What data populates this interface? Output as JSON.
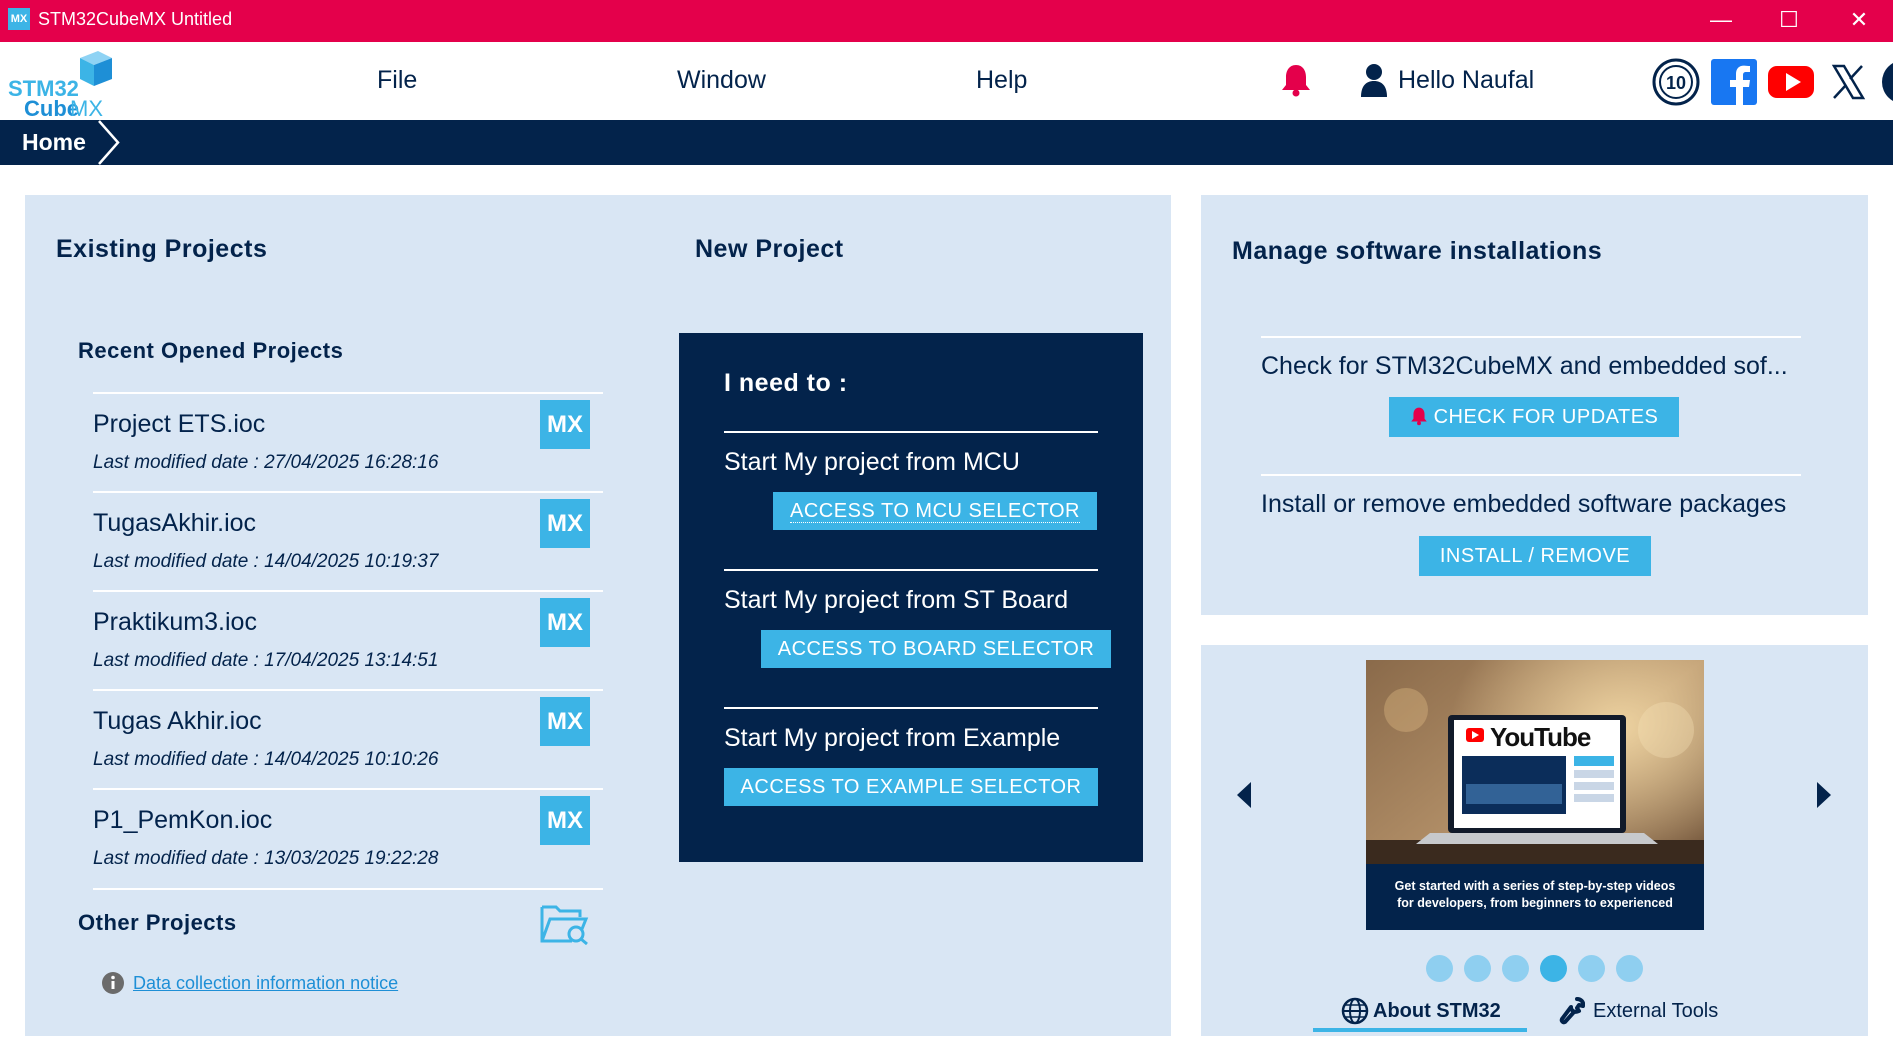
{
  "window": {
    "app_icon": "MX",
    "title": "STM32CubeMX Untitled",
    "controls": {
      "minimize": "—",
      "maximize": "☐",
      "close": "✕"
    }
  },
  "logo": {
    "line1": "STM32",
    "line2_a": "Cube",
    "line2_b": "MX"
  },
  "menu": {
    "file": "File",
    "window": "Window",
    "help": "Help"
  },
  "user": {
    "greeting": "Hello Naufal"
  },
  "social": [
    "anniversary-10-icon",
    "facebook-icon",
    "youtube-icon",
    "x-icon",
    "st-community-icon"
  ],
  "breadcrumb": {
    "home": "Home"
  },
  "existing": {
    "title": "Existing Projects",
    "recent_title": "Recent Opened Projects",
    "projects": [
      {
        "name": "Project ETS.ioc",
        "date": "Last modified date : 27/04/2025 16:28:16",
        "badge": "MX"
      },
      {
        "name": "TugasAkhir.ioc",
        "date": "Last modified date : 14/04/2025 10:19:37",
        "badge": "MX"
      },
      {
        "name": "Praktikum3.ioc",
        "date": "Last modified date : 17/04/2025 13:14:51",
        "badge": "MX"
      },
      {
        "name": "Tugas Akhir.ioc",
        "date": "Last modified date : 14/04/2025 10:10:26",
        "badge": "MX"
      },
      {
        "name": "P1_PemKon.ioc",
        "date": "Last modified date : 13/03/2025 19:22:28",
        "badge": "MX"
      }
    ],
    "other_title": "Other Projects",
    "notice_link": "Data collection information notice"
  },
  "new_project": {
    "title": "New Project",
    "need": "I need to :",
    "sections": [
      {
        "label": "Start My project from MCU",
        "button": "ACCESS TO MCU SELECTOR"
      },
      {
        "label": "Start My project from ST Board",
        "button": "ACCESS TO BOARD SELECTOR"
      },
      {
        "label": "Start My project from Example",
        "button": "ACCESS TO EXAMPLE SELECTOR"
      }
    ]
  },
  "manage": {
    "title": "Manage software installations",
    "check_text": "Check for STM32CubeMX and embedded sof...",
    "check_button": "CHECK FOR UPDATES",
    "install_text": "Install or remove embedded software packages",
    "install_button": "INSTALL / REMOVE"
  },
  "carousel": {
    "brand": "YouTube",
    "caption_line1": "Get started with a series of step-by-step videos",
    "caption_line2": "for developers, from beginners to experienced",
    "dot_count": 6,
    "active_dot_number": 4,
    "tabs": {
      "about": "About STM32",
      "external": "External Tools"
    }
  },
  "colors": {
    "title_bar": "#e4004b",
    "navy": "#03234b",
    "accent": "#3cb4e6",
    "panel": "#d9e6f4"
  }
}
